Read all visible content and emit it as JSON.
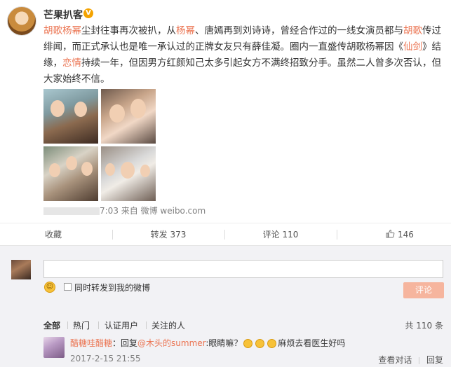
{
  "post": {
    "author": "芒果扒客",
    "vip_badge": "V",
    "text_parts": [
      {
        "t": "胡歌杨幂",
        "hl": true
      },
      {
        "t": "尘封往事再次被扒，从",
        "hl": false
      },
      {
        "t": "杨幂",
        "hl": true
      },
      {
        "t": "、唐嫣再到刘诗诗，曾经合作过的一线女演员都与",
        "hl": false
      },
      {
        "t": "胡歌",
        "hl": true
      },
      {
        "t": "传过绯闻，而正式承认也是唯一承认过的正牌女友只有薛佳凝。圈内一直盛传胡歌杨幂因《",
        "hl": false
      },
      {
        "t": "仙剑",
        "hl": true
      },
      {
        "t": "》结缘，",
        "hl": false
      },
      {
        "t": "恋情",
        "hl": true
      },
      {
        "t": "持续一年，但因男方红颜知己太多引起女方不满终招致分手。虽然二人曾多次否认，但大家始终不信。",
        "hl": false
      }
    ],
    "meta_time_suffix": "7:03",
    "meta_source": "来自 微博 weibo.com"
  },
  "actions": {
    "favorite": "收藏",
    "repost": "转发 373",
    "comment": "评论 110",
    "like_count": "146"
  },
  "compose": {
    "placeholder": "",
    "also_repost_label": "同时转发到我的微博",
    "submit_label": "评论"
  },
  "filters": {
    "all": "全部",
    "hot": "热门",
    "certified": "认证用户",
    "following": "关注的人",
    "total": "共 110 条"
  },
  "comments": [
    {
      "user": "醋糖哇醋糖",
      "prefix": "：回复",
      "mention": "@木头的summer",
      "body_before": ":眼睛嘛？",
      "body_after": "麻烦去看医生好吗",
      "time": "2017-2-15 21:55",
      "view_thread": "查看对话",
      "reply": "回复"
    }
  ],
  "colors": {
    "accent": "#eb7350",
    "submit_bg": "#f6b59e"
  }
}
